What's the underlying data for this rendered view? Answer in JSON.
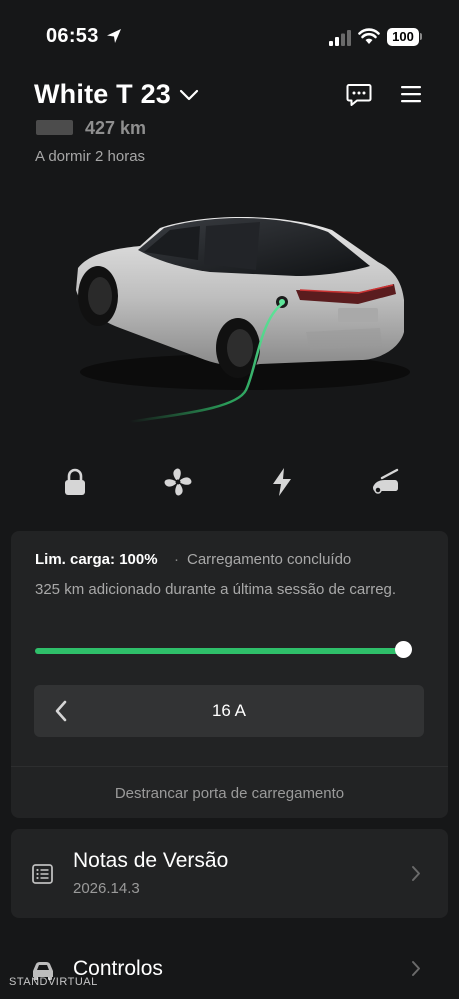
{
  "status_bar": {
    "time": "06:53",
    "battery_percent": "100",
    "icons": [
      "location-arrow-icon",
      "signal-icon",
      "wifi-icon",
      "battery-icon"
    ]
  },
  "header": {
    "car_name": "White T 23",
    "range": "427 km",
    "sleep_status": "A dormir 2 horas",
    "icons": [
      "chevron-down-icon",
      "chat-icon",
      "menu-icon"
    ]
  },
  "quick_actions": [
    {
      "name": "lock",
      "icon": "lock-icon"
    },
    {
      "name": "climate",
      "icon": "fan-icon"
    },
    {
      "name": "charging",
      "icon": "lightning-icon"
    },
    {
      "name": "trunk",
      "icon": "trunk-icon"
    }
  ],
  "charging": {
    "limit_label": "Lim. carga: 100%",
    "separator": "·",
    "status": "Carregamento concluído",
    "added_text": "325 km adicionado durante a última sessão de carreg.",
    "charge_limit_fraction": 1.0,
    "current_value": "16 A",
    "unlock_port_label": "Destrancar porta de carregamento",
    "accent_color": "#2fbf6a"
  },
  "release_notes": {
    "title": "Notas de Versão",
    "version": "2026.14.3"
  },
  "controls": {
    "title": "Controlos"
  },
  "watermark": "STANDVIRTUAL"
}
